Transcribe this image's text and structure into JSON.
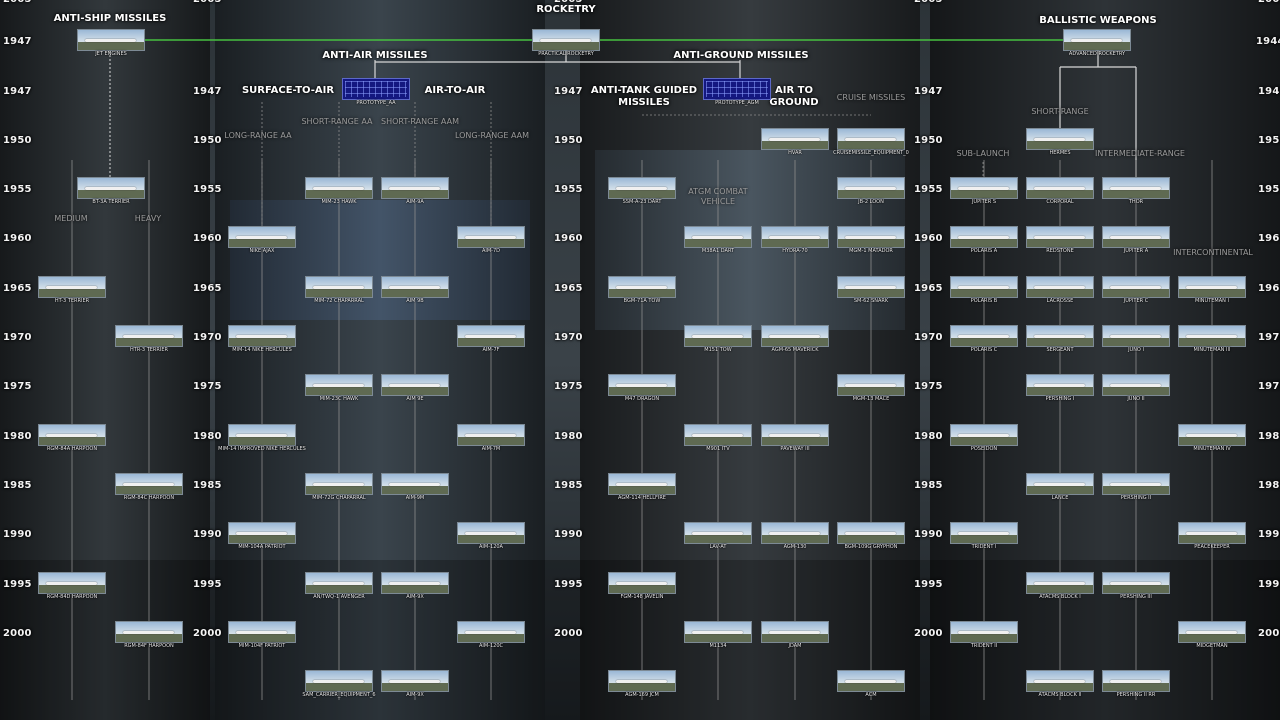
{
  "top_categories": {
    "anti_ship": "ANTI-SHIP MISSILES",
    "rocketry": "ROCKETRY",
    "ballistic": "BALLISTIC WEAPONS",
    "anti_air": "ANTI-AIR MISSILES",
    "anti_ground": "ANTI-GROUND MISSILES",
    "surface_to_air": "SURFACE-TO-AIR",
    "air_to_air": "AIR-TO-AIR",
    "atgm": "ANTI-TANK GUIDED\nMISSILES",
    "air_to_ground": "AIR TO\nGROUND"
  },
  "subcategories": {
    "medium": "MEDIUM",
    "heavy": "HEAVY",
    "long_range_aa": "LONG-RANGE AA",
    "short_range_aa": "SHORT-RANGE AA",
    "short_range_aam": "SHORT-RANGE AAM",
    "long_range_aam": "LONG-RANGE AAM",
    "atgm_vehicle": "ATGM COMBAT\nVEHICLE",
    "cruise": "CRUISE MISSILES",
    "short_range": "SHORT-RANGE",
    "sub_launch": "SUB-LAUNCH",
    "intermediate": "INTERMEDIATE-RANGE",
    "intercontinental": "INTERCONTINENTAL"
  },
  "header_years": {
    "far_left": "1947",
    "far_right": "1944"
  },
  "year_columns": [
    "1947",
    "1950",
    "1955",
    "1960",
    "1965",
    "1970",
    "1975",
    "1980",
    "1985",
    "1990",
    "1995",
    "2000",
    "2005"
  ],
  "colors": {
    "connector_green": "#46c040",
    "connector_white": "#d8d8d8",
    "year_text": "#f4f4f4",
    "subcategory_text": "#9a9a9a"
  },
  "nodes": [
    {
      "id": "jet",
      "label": "JET ENGINES"
    },
    {
      "id": "practical",
      "label": "PRACTICAL ROCKETRY"
    },
    {
      "id": "advanced",
      "label": "ADVANCED ROCKETRY"
    },
    {
      "id": "proto_aa",
      "label": "PROTOTYPE_AA"
    },
    {
      "id": "proto_agm",
      "label": "PROTOTYPE_AGM"
    },
    {
      "id": "bt3a",
      "label": "BT-3A TERRIER"
    },
    {
      "id": "ht3",
      "label": "HT-3 TERRIER"
    },
    {
      "id": "htr3",
      "label": "HTR-3 TERRIER"
    },
    {
      "id": "rgm84a",
      "label": "RGM-84A HARPOON"
    },
    {
      "id": "rgm84c",
      "label": "RGM-84C HARPOON"
    },
    {
      "id": "rgm84d",
      "label": "RGM-84D HARPOON"
    },
    {
      "id": "rgm84f",
      "label": "RGM-84F HARPOON"
    },
    {
      "id": "ajax",
      "label": "NIKE AJAX"
    },
    {
      "id": "mim14",
      "label": "MIM-14 NIKE HERCULES"
    },
    {
      "id": "mim14imp",
      "label": "MIM-14 IMPROVED NIKE HERCULES"
    },
    {
      "id": "mim104a",
      "label": "MIM-104A PATRIOT"
    },
    {
      "id": "mim104f",
      "label": "MIM-104F PATRIOT"
    },
    {
      "id": "hawk",
      "label": "MIM-23 HAWK"
    },
    {
      "id": "chap",
      "label": "MIM-72 CHAPARRAL"
    },
    {
      "id": "hawk23c",
      "label": "MIM-23C HAWK"
    },
    {
      "id": "chap72g",
      "label": "MIM-72G CHAPARRAL"
    },
    {
      "id": "avenger",
      "label": "AN/TWQ-1 AVENGER"
    },
    {
      "id": "samcarrier",
      "label": "SAM_CARRIER_EQUIPMENT_6"
    },
    {
      "id": "aim9a",
      "label": "AIM-9A"
    },
    {
      "id": "aim9b",
      "label": "AIM 9B"
    },
    {
      "id": "aim9e",
      "label": "AIM 9E"
    },
    {
      "id": "aim9m",
      "label": "AIM-9M"
    },
    {
      "id": "aim9x_95",
      "label": "AIM-9X"
    },
    {
      "id": "aim9x_05",
      "label": "AIM-9X"
    },
    {
      "id": "aim7d",
      "label": "AIM-7D"
    },
    {
      "id": "aim7f",
      "label": "AIM-7F"
    },
    {
      "id": "aim7m",
      "label": "AIM-7M"
    },
    {
      "id": "aim120a",
      "label": "AIM-120A"
    },
    {
      "id": "aim120c",
      "label": "AIM-120C"
    },
    {
      "id": "dart",
      "label": "SSM-A-23 DART"
    },
    {
      "id": "tow",
      "label": "BGM-71A TOW"
    },
    {
      "id": "dragon",
      "label": "M47 DRAGON"
    },
    {
      "id": "hellfire",
      "label": "AGM-114 HELLFIRE"
    },
    {
      "id": "javelin",
      "label": "FGM-148 JAVELIN"
    },
    {
      "id": "jcm",
      "label": "AGM-169 JCM"
    },
    {
      "id": "m38a1",
      "label": "M38A1 DART"
    },
    {
      "id": "m151",
      "label": "M151 TOW"
    },
    {
      "id": "m901",
      "label": "M901 ITV"
    },
    {
      "id": "lavat",
      "label": "LAV-AT"
    },
    {
      "id": "m1134",
      "label": "M1134"
    },
    {
      "id": "hvar",
      "label": "HVAR"
    },
    {
      "id": "hydra",
      "label": "HYDRA-70"
    },
    {
      "id": "maverick",
      "label": "AGM-65 MAVERICK"
    },
    {
      "id": "paveway",
      "label": "PAVEWAY III"
    },
    {
      "id": "agm130",
      "label": "AGM-130"
    },
    {
      "id": "jdam",
      "label": "JDAM"
    },
    {
      "id": "cruiseeq",
      "label": "CRUISEMISSILE_EQUIPMENT_0"
    },
    {
      "id": "loon",
      "label": "JB-2 LOON"
    },
    {
      "id": "matador",
      "label": "MGM-1 MATADOR"
    },
    {
      "id": "snark",
      "label": "SM-62 SNARK"
    },
    {
      "id": "mace",
      "label": "MGM-13 MACE"
    },
    {
      "id": "gryphon",
      "label": "BGM-109G GRYPHON"
    },
    {
      "id": "acm",
      "label": "ACM"
    },
    {
      "id": "jupiters",
      "label": "JUPITER S"
    },
    {
      "id": "polarisa",
      "label": "POLARIS A"
    },
    {
      "id": "polarisb",
      "label": "POLARIS B"
    },
    {
      "id": "polarisc",
      "label": "POLARIS C"
    },
    {
      "id": "poseidon",
      "label": "POSEIDON"
    },
    {
      "id": "trident1",
      "label": "TRIDENT I"
    },
    {
      "id": "trident2",
      "label": "TRIDENT II"
    },
    {
      "id": "hermes",
      "label": "HERMES"
    },
    {
      "id": "corporal",
      "label": "CORPORAL"
    },
    {
      "id": "redstone",
      "label": "REDSTONE"
    },
    {
      "id": "lacrosse",
      "label": "LACROSSE"
    },
    {
      "id": "sergeant",
      "label": "SERGEANT"
    },
    {
      "id": "pershing1",
      "label": "PERSHING I"
    },
    {
      "id": "lance",
      "label": "LANCE"
    },
    {
      "id": "atacms1",
      "label": "ATACMS BLOCK I"
    },
    {
      "id": "atacms2",
      "label": "ATACMS BLOCK II"
    },
    {
      "id": "thor",
      "label": "THOR"
    },
    {
      "id": "jupitera",
      "label": "JUPITER A"
    },
    {
      "id": "jupiterc",
      "label": "JUPITER C"
    },
    {
      "id": "juno1",
      "label": "JUNO I"
    },
    {
      "id": "juno2",
      "label": "JUNO II"
    },
    {
      "id": "pershing2",
      "label": "PERSHING II"
    },
    {
      "id": "pershing3",
      "label": "PERSHING III"
    },
    {
      "id": "pershing2rr",
      "label": "PERSHING II RR"
    },
    {
      "id": "minuteman1",
      "label": "MINUTEMAN I"
    },
    {
      "id": "minuteman3",
      "label": "MINUTEMAN III"
    },
    {
      "id": "minuteman4",
      "label": "MINUTEMAN IV"
    },
    {
      "id": "peacekeeper",
      "label": "PEACEKEEPER"
    },
    {
      "id": "midgetman",
      "label": "MIDGETMAN"
    }
  ]
}
